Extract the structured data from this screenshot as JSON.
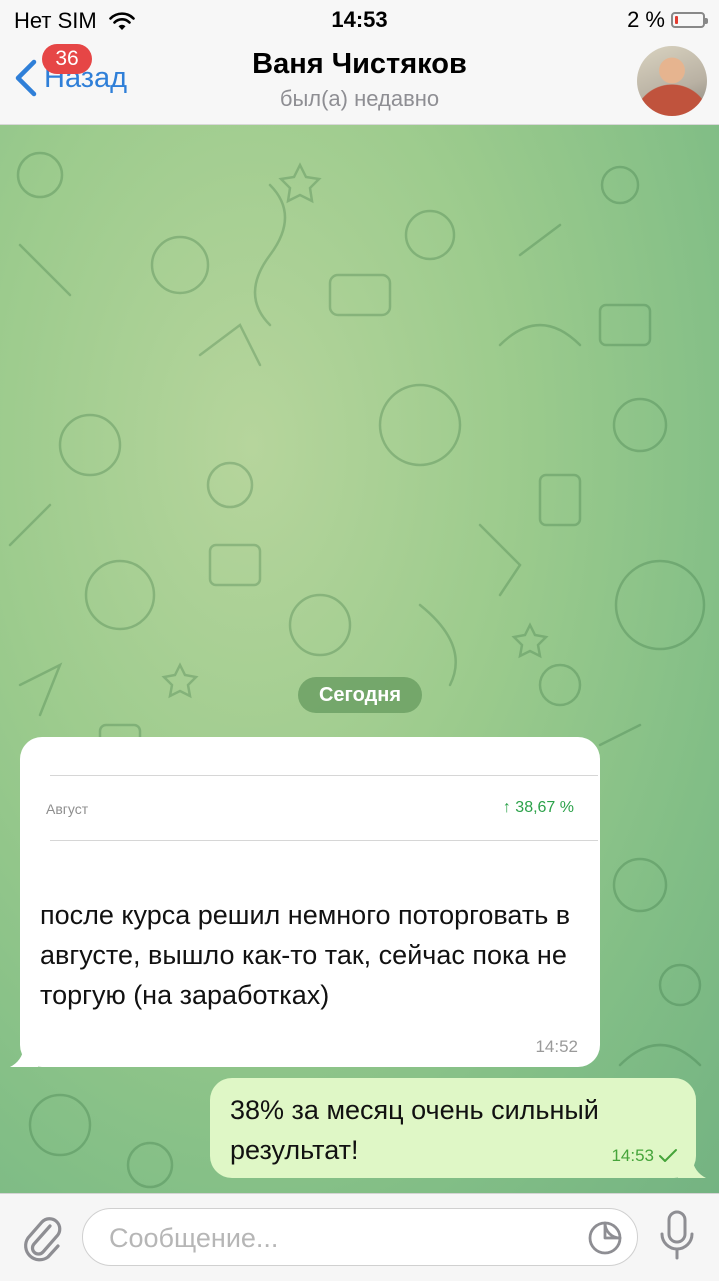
{
  "status_bar": {
    "carrier": "Нет SIM",
    "time": "14:53",
    "battery": "2 %"
  },
  "nav": {
    "back_label": "Назад",
    "unread_badge": "36",
    "contact_name": "Ваня Чистяков",
    "contact_status": "был(а) недавно"
  },
  "chat": {
    "date_label": "Сегодня",
    "incoming": {
      "embed_month": "Август",
      "embed_value": "↑ 38,67 %",
      "text": "после курса решил немного поторговать в августе, вышло как-то так, сейчас пока не торгую (на заработках)",
      "time": "14:52"
    },
    "outgoing": {
      "text": "38% за месяц очень сильный результат!",
      "time": "14:53",
      "status_icon": "single-check-icon"
    }
  },
  "composer": {
    "placeholder": "Сообщение..."
  },
  "colors": {
    "accent": "#2f7fd8",
    "badge": "#e64646",
    "outgoing_bubble": "#dff7c6",
    "positive": "#2ca24a"
  }
}
